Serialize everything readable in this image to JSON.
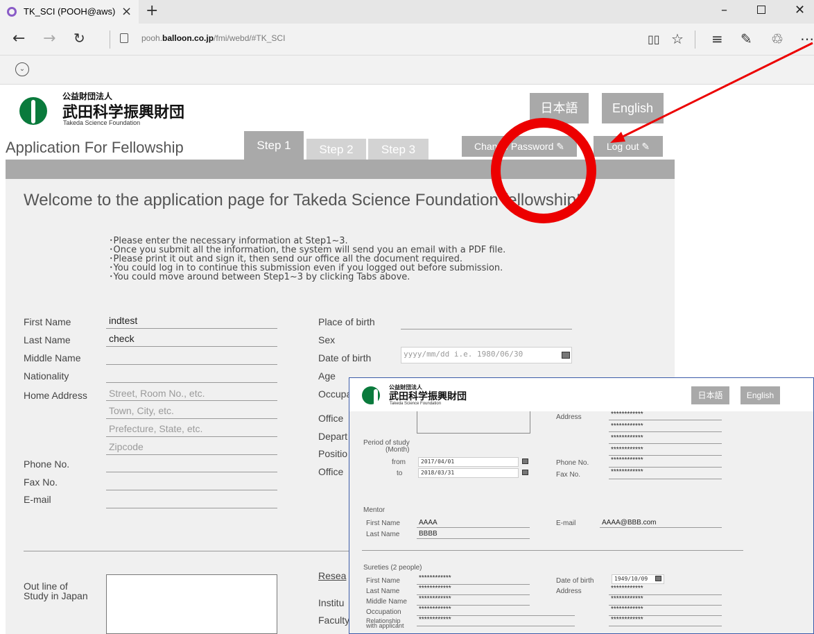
{
  "browser": {
    "tab_title": "TK_SCI (POOH@aws)",
    "tab_close": "×",
    "new_tab": "+",
    "url_prefix": "pooh.",
    "url_domain": "balloon.co.jp",
    "url_path": "/fmi/webd/#TK_SCI"
  },
  "header": {
    "logo_small": "公益財団法人",
    "logo_big": "武田科学振興財団",
    "logo_en": "Takeda Science Foundation",
    "lang_ja": "日本語",
    "lang_en": "English"
  },
  "nav": {
    "app_title": "Application For Fellowship",
    "step1": "Step 1",
    "step2": "Step 2",
    "step3": "Step 3",
    "change_password": "Change Password ✎",
    "log_out": "Log out ✎"
  },
  "main": {
    "welcome": "Welcome to the application page for Takeda Science Foundation fellowship!",
    "instructions": [
      "･Please enter the necessary information at Step1~3.",
      "･Once you submit all the information, the system will send you an email with a  PDF file.",
      "･Please print it out and sign it, then send our office all the document required.",
      "･You could log in to continue this submission even if you logged out before submission.",
      "･You could move around between Step1~3 by clicking Tabs above."
    ]
  },
  "form_left": {
    "first_name_label": "First Name",
    "first_name_value": "indtest",
    "last_name_label": "Last Name",
    "last_name_value": "check",
    "middle_name_label": "Middle Name",
    "nationality_label": "Nationality",
    "home_address_label": "Home Address",
    "address_ph_1": "Street, Room No., etc.",
    "address_ph_2": "Town, City, etc.",
    "address_ph_3": "Prefecture, State, etc.",
    "address_ph_4": "Zipcode",
    "phone_label": "Phone No.",
    "fax_label": "Fax No.",
    "email_label": "E-mail",
    "outline_label_1": "Out line of",
    "outline_label_2": "Study in Japan"
  },
  "form_right": {
    "place_of_birth": "Place of birth",
    "sex": "Sex",
    "date_of_birth": "Date of birth",
    "dob_placeholder": "yyyy/mm/dd i.e. 1980/06/30",
    "age": "Age",
    "occupation_partial": "Occupa",
    "office_partial": "Office",
    "department_partial": "Depart",
    "position_partial": "Positio",
    "office2_partial": "Office",
    "research_partial": "Resea",
    "institution_partial": "Institu",
    "faculty_partial": "Faculty"
  },
  "overlay": {
    "logo_small": "公益財団法人",
    "logo_big": "武田科学振興財団",
    "logo_en": "Takeda Science Foundation",
    "lang_ja": "日本語",
    "lang_en": "English",
    "address_label": "Address",
    "masked": "************",
    "period_label_1": "Period of study",
    "period_label_2": "(Month)",
    "from_label": "from",
    "from_value": "2017/04/01",
    "to_label": "to",
    "to_value": "2018/03/31",
    "phone_label": "Phone No.",
    "fax_label": "Fax No.",
    "mentor_label": "Mentor",
    "mentor_first_label": "First Name",
    "mentor_first_value": "AAAA",
    "mentor_last_label": "Last Name",
    "mentor_last_value": "BBBB",
    "mentor_email_label": "E-mail",
    "mentor_email_value": "AAAA@BBB.com",
    "sureties_label": "Sureties (2 people)",
    "s_first_label": "First Name",
    "s_last_label": "Last Name",
    "s_middle_label": "Middle Name",
    "s_occupation_label": "Occupation",
    "s_relationship_label_1": "Relationship",
    "s_relationship_label_2": "with applicant",
    "s_dob_label": "Date of birth",
    "s_dob_value": "1949/10/09",
    "s_address_label": "Address"
  },
  "colors": {
    "annotation_red": "#ec0000",
    "button_gray": "#a9a9a9",
    "panel_bg": "#f0f0f0",
    "logo_green": "#0a7a3c"
  }
}
